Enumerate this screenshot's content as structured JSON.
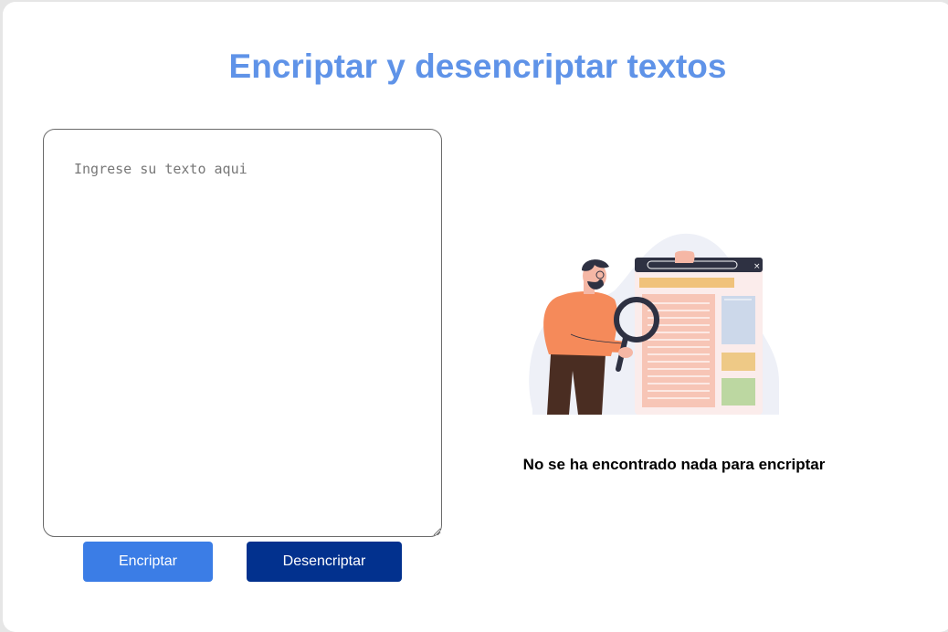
{
  "page": {
    "title": "Encriptar y desencriptar textos"
  },
  "input": {
    "placeholder": "Ingrese su texto aqui",
    "value": ""
  },
  "buttons": {
    "encrypt_label": "Encriptar",
    "decrypt_label": "Desencriptar"
  },
  "result": {
    "empty_message": "No se ha encontrado nada para encriptar",
    "illustration": "man-with-magnifying-glass-searching-document-illustration"
  },
  "colors": {
    "title": "#5f93e8",
    "encrypt_button": "#3b7de6",
    "decrypt_button": "#02318e",
    "background": "#e6e6e6",
    "card": "#ffffff"
  }
}
